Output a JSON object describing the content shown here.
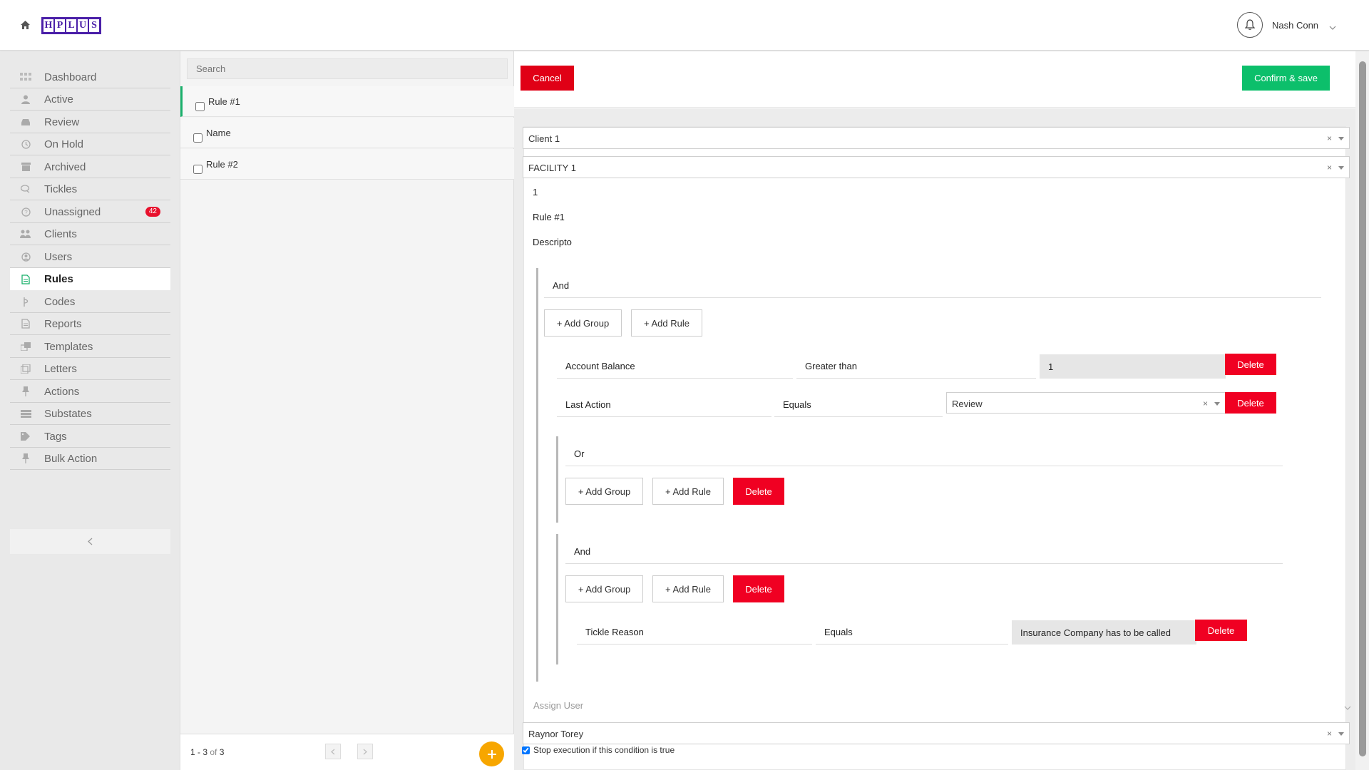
{
  "header": {
    "logo_letters": [
      "H",
      "P",
      "L",
      "U",
      "S"
    ],
    "user_name": "Nash Conn"
  },
  "sidebar": {
    "items": [
      {
        "label": "Dashboard",
        "icon": "dashboard-icon"
      },
      {
        "label": "Active",
        "icon": "user-icon"
      },
      {
        "label": "Review",
        "icon": "inbox-icon"
      },
      {
        "label": "On Hold",
        "icon": "clock-icon"
      },
      {
        "label": "Archived",
        "icon": "archive-icon"
      },
      {
        "label": "Tickles",
        "icon": "chat-icon"
      },
      {
        "label": "Unassigned",
        "icon": "question-icon",
        "badge": "42"
      },
      {
        "label": "Clients",
        "icon": "group-icon"
      },
      {
        "label": "Users",
        "icon": "user-circle-icon"
      },
      {
        "label": "Rules",
        "icon": "document-icon",
        "active": true
      },
      {
        "label": "Codes",
        "icon": "code-icon"
      },
      {
        "label": "Reports",
        "icon": "report-icon"
      },
      {
        "label": "Templates",
        "icon": "template-icon"
      },
      {
        "label": "Letters",
        "icon": "letter-icon"
      },
      {
        "label": "Actions",
        "icon": "pin-icon"
      },
      {
        "label": "Substates",
        "icon": "list-icon"
      },
      {
        "label": "Tags",
        "icon": "tag-icon"
      },
      {
        "label": "Bulk Action",
        "icon": "pin-icon"
      }
    ]
  },
  "list": {
    "search_placeholder": "Search",
    "rows": [
      {
        "label": "Rule #1",
        "active": true
      },
      {
        "label": "Name"
      },
      {
        "label": "Rule #2"
      }
    ],
    "pager": {
      "range": "1 - 3",
      "of_label": "of",
      "total": "3"
    }
  },
  "editor": {
    "cancel_label": "Cancel",
    "confirm_label": "Confirm & save",
    "client_select": "Client 1",
    "facility_select": "FACILITY 1",
    "rule_id": "1",
    "rule_name": "Rule #1",
    "rule_description": "Descripto",
    "root_group": {
      "combinator": "And",
      "add_group_label": "+ Add Group",
      "add_rule_label": "+ Add Rule",
      "rules": [
        {
          "field": "Account Balance",
          "operator": "Greater than",
          "value": "1",
          "delete_label": "Delete"
        },
        {
          "field": "Last Action",
          "operator": "Equals",
          "value": "Review",
          "delete_label": "Delete"
        }
      ],
      "subgroups": [
        {
          "combinator": "Or",
          "add_group_label": "+ Add Group",
          "add_rule_label": "+ Add Rule",
          "delete_label": "Delete"
        },
        {
          "combinator": "And",
          "add_group_label": "+ Add Group",
          "add_rule_label": "+ Add Rule",
          "delete_label": "Delete",
          "rule": {
            "field": "Tickle Reason",
            "operator": "Equals",
            "value": "Insurance Company has to be called",
            "delete_label": "Delete"
          }
        }
      ]
    },
    "assign_user_label": "Assign User",
    "assigned_user": "Raynor Torey",
    "stop_execution_label": "Stop execution if this condition is true",
    "clear_symbol": "×"
  },
  "colors": {
    "brand": "#4a1fa8",
    "accent_green": "#0cbf6b",
    "danger": "#e00016",
    "fab": "#f7a600"
  }
}
